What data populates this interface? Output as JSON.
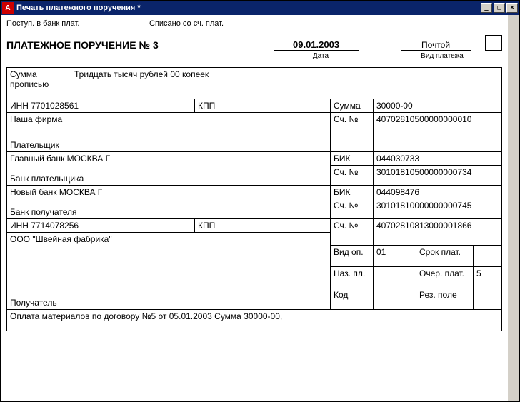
{
  "window": {
    "title": "Печать платежного поручения  *"
  },
  "top": {
    "postup": "Поступ. в банк плат.",
    "spisano": "Списано со сч. плат."
  },
  "header": {
    "title": "ПЛАТЕЖНОЕ ПОРУЧЕНИЕ № 3",
    "date": "09.01.2003",
    "date_label": "Дата",
    "vid": "Почтой",
    "vid_label": "Вид платежа"
  },
  "summa_propis": {
    "label": "Сумма\nпрописью",
    "value": "Тридцать тысяч рублей 00 копеек"
  },
  "payer": {
    "inn_label": "ИНН",
    "inn": "7701028561",
    "kpp_label": "КПП",
    "kpp": "",
    "name": "Наша фирма",
    "role": "Плательщик",
    "summa_label": "Сумма",
    "summa": "30000-00",
    "sch_label": "Сч. №",
    "sch": "40702810500000000010"
  },
  "payer_bank": {
    "name": "Главный банк МОСКВА Г",
    "role": "Банк плательщика",
    "bik_label": "БИК",
    "bik": "044030733",
    "sch_label": "Сч. №",
    "sch": "30101810500000000734"
  },
  "payee_bank": {
    "name": "Новый банк МОСКВА Г",
    "role": "Банк получателя",
    "bik_label": "БИК",
    "bik": "044098476",
    "sch_label": "Сч. №",
    "sch": "30101810000000000745"
  },
  "payee": {
    "inn_label": "ИНН",
    "inn": "7714078256",
    "kpp_label": "КПП",
    "kpp": "",
    "name": "ООО \"Швейная фабрика\"",
    "role": "Получатель",
    "sch_label": "Сч. №",
    "sch": "40702810813000001866"
  },
  "footer": {
    "vid_op_label": "Вид оп.",
    "vid_op": "01",
    "srok_label": "Срок плат.",
    "srok": "",
    "naz_label": "Наз. пл.",
    "naz": "",
    "ocher_label": "Очер. плат.",
    "ocher": "5",
    "kod_label": "Код",
    "kod": "",
    "rez_label": "Рез. поле",
    "rez": ""
  },
  "purpose": "Оплата материалов по договору №5 от 05.01.2003 Сумма 30000-00,"
}
